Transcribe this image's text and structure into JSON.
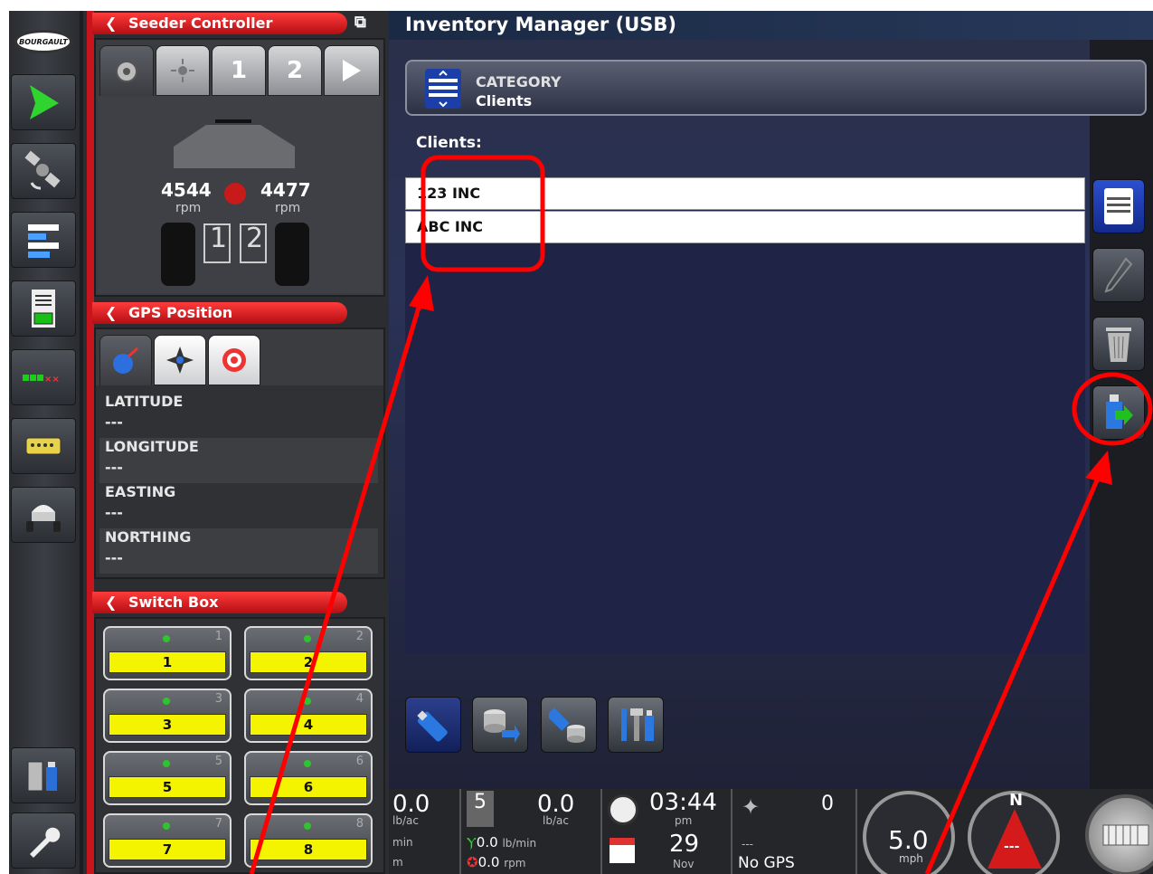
{
  "left_toolbar": {
    "logo_text": "BOURGAULT",
    "items": [
      {
        "icon": "guidance-arrow-icon"
      },
      {
        "icon": "satellite-icon"
      },
      {
        "icon": "layers-list-icon"
      },
      {
        "icon": "seed-report-icon"
      },
      {
        "icon": "section-status-icon",
        "text": "■■■××"
      },
      {
        "icon": "switchbox-icon"
      },
      {
        "icon": "seeder-cart-icon"
      },
      {
        "icon": "inventory-usb-icon"
      },
      {
        "icon": "wrench-icon"
      }
    ]
  },
  "seeder_controller": {
    "title": "Seeder Controller",
    "tabs": [
      "",
      "",
      "1",
      "2",
      ""
    ],
    "rpm_left": "4544",
    "rpm_right": "4477",
    "rpm_unit": "rpm",
    "tank_labels": [
      "1",
      "2"
    ]
  },
  "gps_position": {
    "title": "GPS Position",
    "rows": [
      {
        "label": "LATITUDE",
        "value": "---"
      },
      {
        "label": "LONGITUDE",
        "value": "---"
      },
      {
        "label": "EASTING",
        "value": "---"
      },
      {
        "label": "NORTHING",
        "value": "---"
      }
    ]
  },
  "switch_box": {
    "title": "Switch Box",
    "switches": [
      {
        "num": "1",
        "label": "1"
      },
      {
        "num": "2",
        "label": "2"
      },
      {
        "num": "3",
        "label": "3"
      },
      {
        "num": "4",
        "label": "4"
      },
      {
        "num": "5",
        "label": "5"
      },
      {
        "num": "6",
        "label": "6"
      },
      {
        "num": "7",
        "label": "7"
      },
      {
        "num": "8",
        "label": "8"
      }
    ]
  },
  "main": {
    "title": "Inventory Manager (USB)",
    "category_heading": "CATEGORY",
    "category_value": "Clients",
    "list_label": "Clients:",
    "clients": [
      "123 INC",
      "ABC INC"
    ]
  },
  "side_actions": [
    {
      "icon": "category-list-icon"
    },
    {
      "icon": "edit-pencil-icon"
    },
    {
      "icon": "trash-icon"
    },
    {
      "icon": "usb-export-icon"
    }
  ],
  "bottom_actions": [
    {
      "icon": "usb-drive-icon"
    },
    {
      "icon": "database-import-icon"
    },
    {
      "icon": "usb-to-database-icon"
    },
    {
      "icon": "usb-tools-icon"
    }
  ],
  "status_bar": {
    "rate1_value": "0.0",
    "rate1_unit": "lb/ac",
    "rate1_sub": "min",
    "rate1_sub2": "m",
    "tank_num": "5",
    "rate2_value": "0.0",
    "rate2_unit": "lb/ac",
    "flow": "0.0",
    "flow_unit": "lb/min",
    "fan": "0.0",
    "fan_unit": "rpm",
    "time": "03:44",
    "ampm": "pm",
    "day": "29",
    "month": "Nov",
    "sat_count": "0",
    "corr": "---",
    "gps_status": "No GPS",
    "speed": "5.0",
    "speed_unit": "mph",
    "compass_n": "N",
    "heading": "---"
  },
  "colors": {
    "accent_red": "#c8141c",
    "switch_yellow": "#f4f400",
    "annotation_red": "#ff0000"
  }
}
